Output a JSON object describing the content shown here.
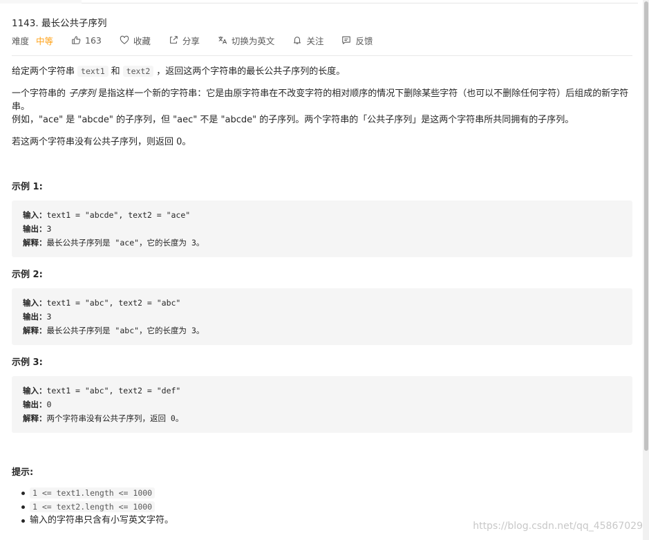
{
  "problem": {
    "title": "1143. 最长公共子序列",
    "difficulty_label": "难度",
    "difficulty_value": "中等",
    "likes": "163",
    "favorite_label": "收藏",
    "share_label": "分享",
    "switch_lang_label": "切换为英文",
    "follow_label": "关注",
    "feedback_label": "反馈"
  },
  "description": {
    "p1_pre": "给定两个字符串",
    "p1_code1": "text1",
    "p1_mid": "和",
    "p1_code2": "text2",
    "p1_post": "，返回这两个字符串的最长公共子序列的长度。",
    "p2_pre": "一个字符串的 ",
    "p2_em": "子序列",
    "p2_post": " 是指这样一个新的字符串：它是由原字符串在不改变字符的相对顺序的情况下删除某些字符（也可以不删除任何字符）后组成的新字符",
    "p2_line2": "串。",
    "p3": "例如，\"ace\" 是 \"abcde\" 的子序列，但 \"aec\" 不是 \"abcde\" 的子序列。两个字符串的「公共子序列」是这两个字符串所共同拥有的子序列。",
    "p4": "若这两个字符串没有公共子序列，则返回 0。"
  },
  "labels": {
    "input": "输入：",
    "output": "输出：",
    "explanation": "解释："
  },
  "examples": [
    {
      "title": "示例 1:",
      "input": "text1 = \"abcde\", text2 = \"ace\"",
      "output": "3",
      "explanation": "最长公共子序列是 \"ace\"，它的长度为 3。"
    },
    {
      "title": "示例 2:",
      "input": "text1 = \"abc\", text2 = \"abc\"",
      "output": "3",
      "explanation": "最长公共子序列是 \"abc\"，它的长度为 3。"
    },
    {
      "title": "示例 3:",
      "input": "text1 = \"abc\", text2 = \"def\"",
      "output": "0",
      "explanation": "两个字符串没有公共子序列，返回 0。"
    }
  ],
  "hints": {
    "title": "提示:",
    "items": [
      "1 <= text1.length <= 1000",
      "1 <= text2.length <= 1000",
      "输入的字符串只含有小写英文字符。"
    ]
  },
  "watermark": "https://blog.csdn.net/qq_45867029",
  "colors": {
    "difficulty_medium": "#ffa116",
    "code_bg": "#f5f5f5",
    "text": "#262626"
  }
}
